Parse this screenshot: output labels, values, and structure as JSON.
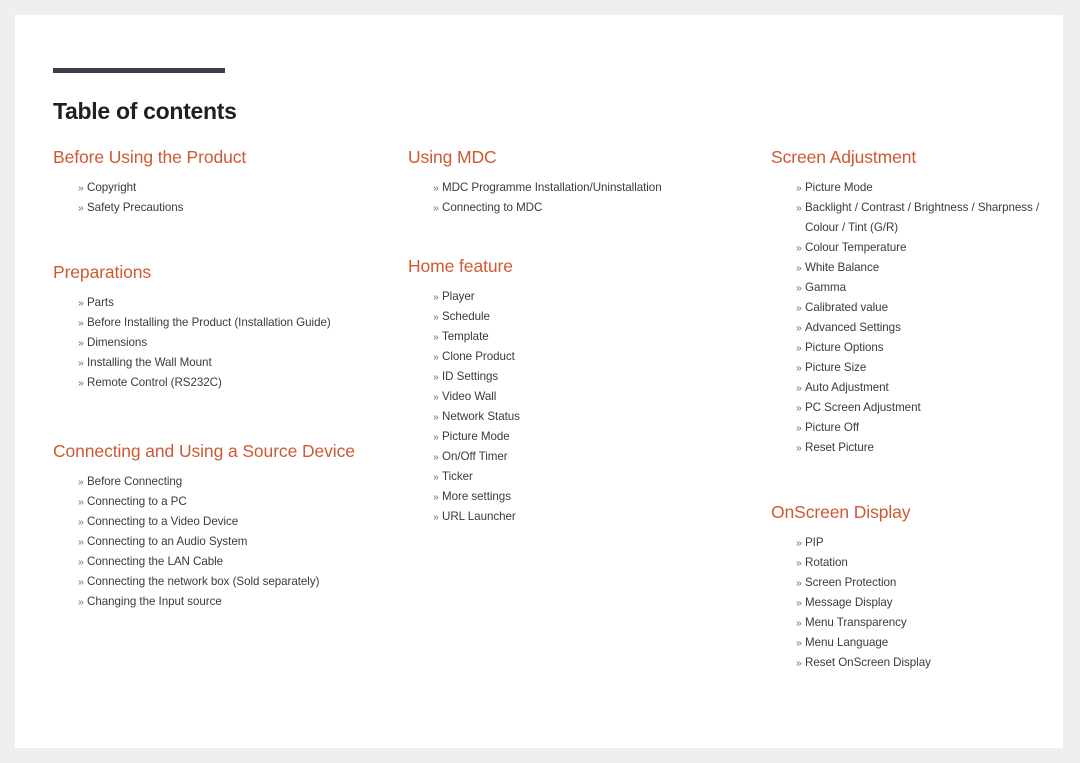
{
  "document": {
    "title": "Table of contents",
    "marker": "»",
    "accent_color": "#cd5a34",
    "rule_color": "#3e3e4b",
    "text_color": "#3b3b3b",
    "page_background": "#ffffff",
    "canvas_background": "#efefef"
  },
  "columns": [
    {
      "sections": [
        {
          "heading": "Before Using the Product",
          "items": [
            "Copyright",
            "Safety Precautions"
          ]
        },
        {
          "heading": "Preparations",
          "items": [
            "Parts",
            "Before Installing the Product (Installation Guide)",
            "Dimensions",
            "Installing the Wall Mount",
            "Remote Control (RS232C)"
          ]
        },
        {
          "heading": "Connecting and Using a Source Device",
          "items": [
            "Before Connecting",
            "Connecting to a PC",
            "Connecting to a Video Device",
            "Connecting to an Audio System",
            "Connecting the LAN Cable",
            "Connecting the network box (Sold separately)",
            "Changing the Input source"
          ]
        }
      ]
    },
    {
      "sections": [
        {
          "heading": "Using MDC",
          "items": [
            "MDC Programme Installation/Uninstallation",
            "Connecting to MDC"
          ]
        },
        {
          "heading": "Home feature",
          "items": [
            "Player",
            "Schedule",
            "Template",
            "Clone Product",
            "ID Settings",
            "Video Wall",
            "Network Status",
            "Picture Mode",
            "On/Off Timer",
            "Ticker",
            "More settings",
            "URL Launcher"
          ]
        }
      ]
    },
    {
      "sections": [
        {
          "heading": "Screen Adjustment",
          "items": [
            "Picture Mode",
            "Backlight / Contrast / Brightness / Sharpness / Colour / Tint (G/R)",
            "Colour Temperature",
            "White Balance",
            "Gamma",
            "Calibrated value",
            "Advanced Settings",
            "Picture Options",
            "Picture Size",
            "Auto Adjustment",
            "PC Screen Adjustment",
            "Picture Off",
            "Reset Picture"
          ]
        },
        {
          "heading": "OnScreen Display",
          "items": [
            "PIP",
            "Rotation",
            "Screen Protection",
            "Message Display",
            "Menu Transparency",
            "Menu Language",
            "Reset OnScreen Display"
          ]
        }
      ]
    }
  ]
}
